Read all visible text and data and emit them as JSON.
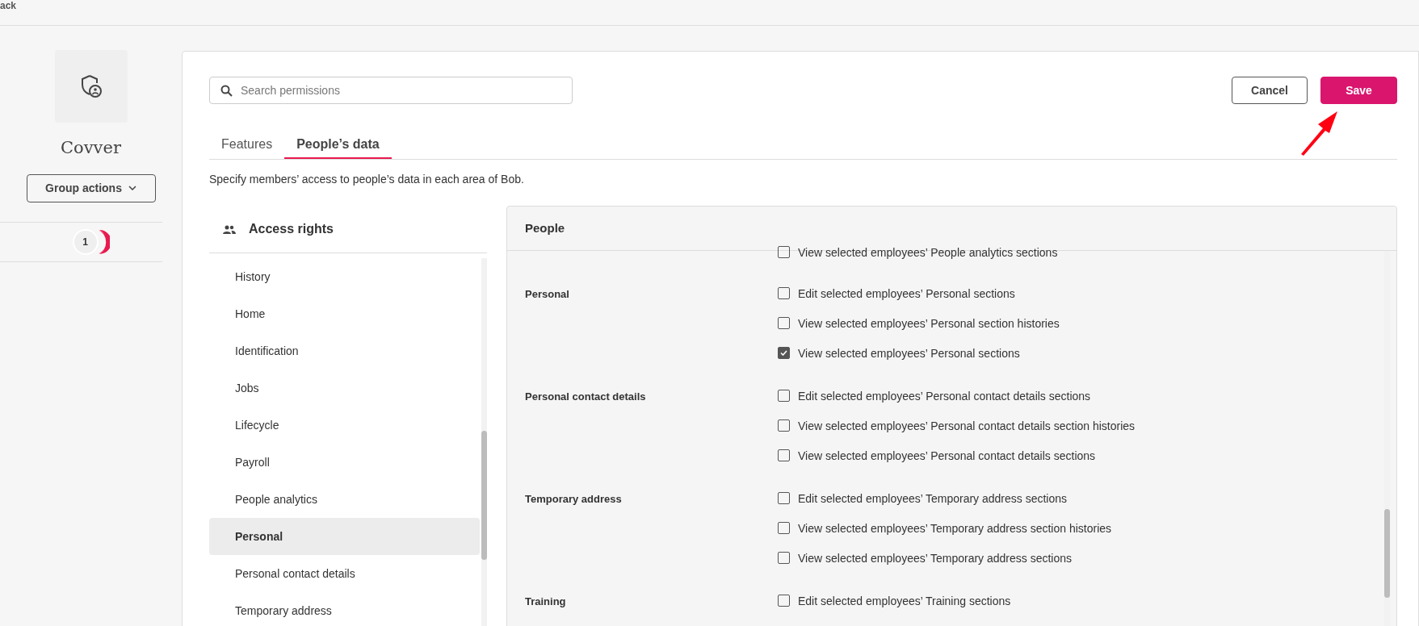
{
  "top_bar": {
    "text": "ack"
  },
  "group": {
    "name": "Covver",
    "actions_button": "Group actions",
    "member_count": "1"
  },
  "search": {
    "placeholder": "Search permissions"
  },
  "buttons": [
    {
      "label": "Cancel",
      "kind": "secondary"
    },
    {
      "label": "Save",
      "kind": "primary"
    }
  ],
  "tabs": [
    {
      "label": "Features",
      "selected": false
    },
    {
      "label": "People’s data",
      "selected": true
    }
  ],
  "description": "Specify members’ access to people’s data in each area of Bob.",
  "access_rights": {
    "title": "Access rights",
    "items": [
      {
        "label": "History",
        "selected": false
      },
      {
        "label": "Home",
        "selected": false
      },
      {
        "label": "Identification",
        "selected": false
      },
      {
        "label": "Jobs",
        "selected": false
      },
      {
        "label": "Lifecycle",
        "selected": false
      },
      {
        "label": "Payroll",
        "selected": false
      },
      {
        "label": "People analytics",
        "selected": false
      },
      {
        "label": "Personal",
        "selected": true
      },
      {
        "label": "Personal contact details",
        "selected": false
      },
      {
        "label": "Temporary address",
        "selected": false
      }
    ]
  },
  "panel": {
    "title": "People",
    "sections": [
      {
        "permissions": [
          {
            "label": "View selected employees’ People analytics sections",
            "checked": false
          }
        ]
      },
      {
        "label": "Personal",
        "permissions": [
          {
            "label": "Edit selected employees’ Personal sections",
            "checked": false
          },
          {
            "label": "View selected employees’ Personal section histories",
            "checked": false
          },
          {
            "label": "View selected employees’ Personal sections",
            "checked": true
          }
        ]
      },
      {
        "label": "Personal contact details",
        "permissions": [
          {
            "label": "Edit selected employees’ Personal contact details sections",
            "checked": false
          },
          {
            "label": "View selected employees’ Personal contact details section histories",
            "checked": false
          },
          {
            "label": "View selected employees’ Personal contact details sections",
            "checked": false
          }
        ]
      },
      {
        "label": "Temporary address",
        "permissions": [
          {
            "label": "Edit selected employees’ Temporary address sections",
            "checked": false
          },
          {
            "label": "View selected employees’ Temporary address section histories",
            "checked": false
          },
          {
            "label": "View selected employees’ Temporary address sections",
            "checked": false
          }
        ]
      },
      {
        "label": "Training",
        "permissions": [
          {
            "label": "Edit selected employees’ Training sections",
            "checked": false
          }
        ]
      }
    ]
  }
}
